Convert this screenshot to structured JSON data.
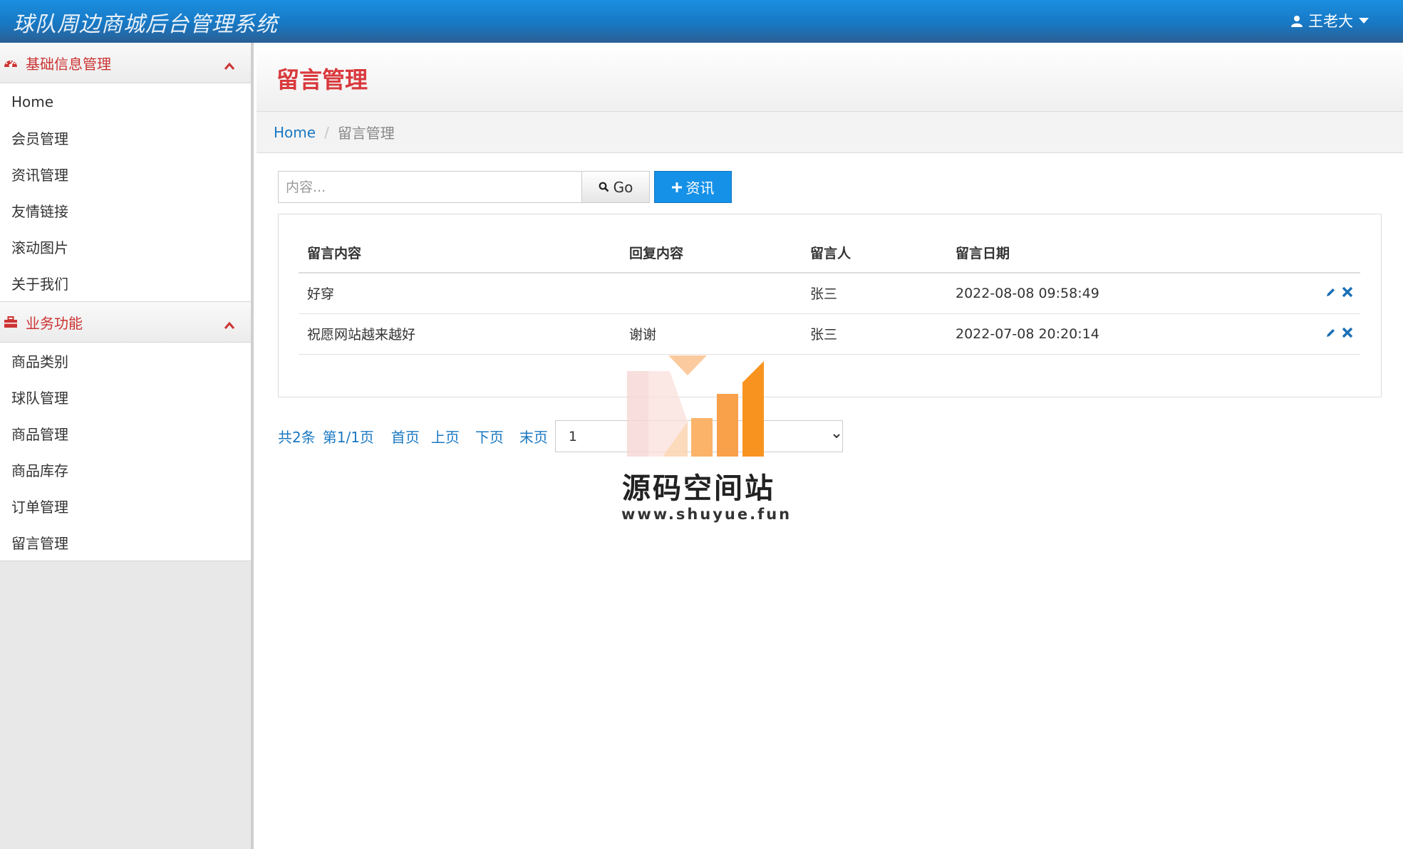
{
  "header": {
    "app_title": "球队周边商城后台管理系统",
    "user_name": "王老大"
  },
  "sidebar": {
    "groups": [
      {
        "label": "基础信息管理",
        "items": [
          "Home",
          "会员管理",
          "资讯管理",
          "友情链接",
          "滚动图片",
          "关于我们"
        ]
      },
      {
        "label": "业务功能",
        "items": [
          "商品类别",
          "球队管理",
          "商品管理",
          "商品库存",
          "订单管理",
          "留言管理"
        ]
      }
    ]
  },
  "page": {
    "title": "留言管理",
    "breadcrumb": {
      "home": "Home",
      "sep": "/",
      "current": "留言管理"
    }
  },
  "toolbar": {
    "search_placeholder": "内容...",
    "go_label": "Go",
    "add_label": "资讯"
  },
  "table": {
    "columns": [
      "留言内容",
      "回复内容",
      "留言人",
      "留言日期"
    ],
    "rows": [
      {
        "content": "好穿",
        "reply": "",
        "author": "张三",
        "date": "2022-08-08 09:58:49"
      },
      {
        "content": "祝愿网站越来越好",
        "reply": "谢谢",
        "author": "张三",
        "date": "2022-07-08 20:20:14"
      }
    ]
  },
  "pager": {
    "total": "共2条",
    "page_info": "第1/1页",
    "first": "首页",
    "prev": "上页",
    "next": "下页",
    "last": "末页",
    "selected_page": "1"
  },
  "watermark": {
    "title": "源码空间站",
    "url": "www.shuyue.fun"
  },
  "colors": {
    "header_blue": "#1878c4",
    "accent_red": "#d9393d",
    "link_blue": "#1a78c2",
    "add_button": "#1591e8",
    "action_icon": "#1a6fb5",
    "watermark_orange": "#f7931e"
  },
  "icons": {
    "user": "user-icon",
    "caret": "caret-down-icon",
    "dashboard": "dashboard-icon",
    "briefcase": "briefcase-icon",
    "chevron": "chevron-up-icon",
    "search": "search-icon",
    "plus": "plus-icon",
    "edit": "pencil-icon",
    "delete": "close-icon"
  }
}
